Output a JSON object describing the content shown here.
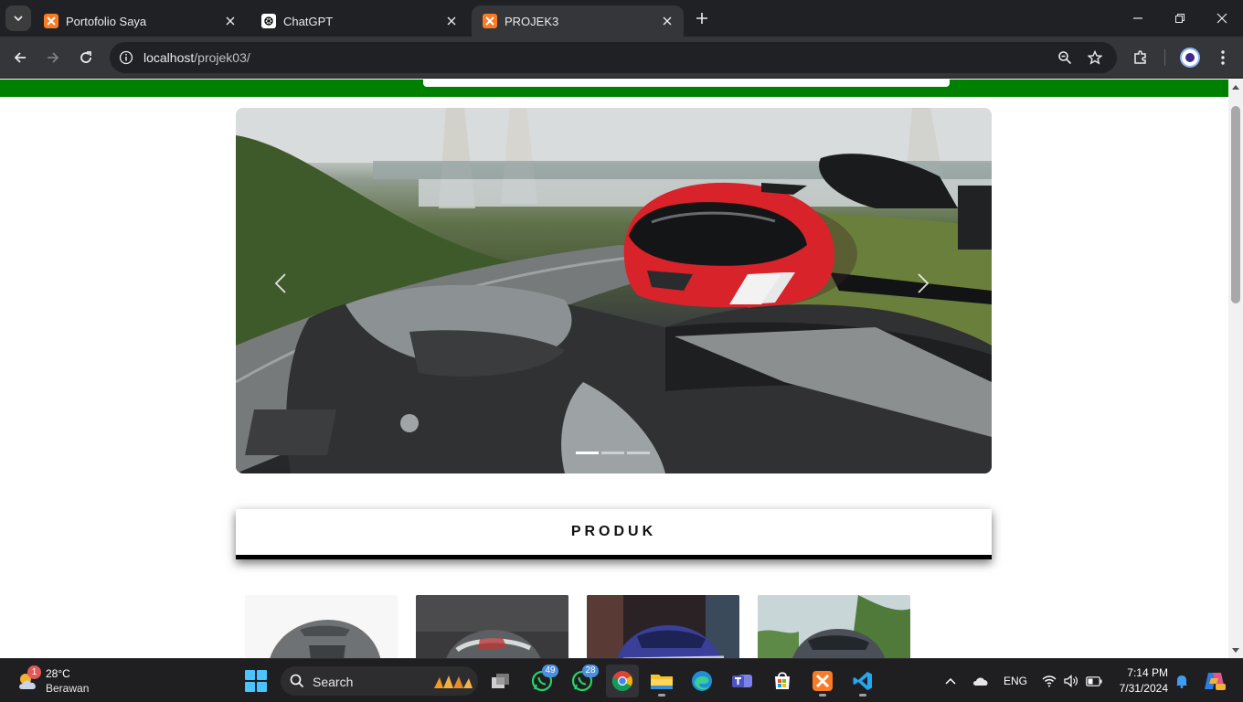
{
  "browser": {
    "tabs": [
      {
        "title": "Portofolio Saya",
        "favicon": "xampp-icon",
        "active": false
      },
      {
        "title": "ChatGPT",
        "favicon": "chatgpt-icon",
        "active": false
      },
      {
        "title": "PROJEK3",
        "favicon": "xampp-icon",
        "active": true
      }
    ],
    "url_host": "localhost",
    "url_path": "/projek03/"
  },
  "page": {
    "nav_color": "#008000",
    "carousel": {
      "slide_count": 3,
      "active_slide": 1,
      "prev_label": "Previous",
      "next_label": "Next"
    },
    "section_title": "PRODUK",
    "product_cards": [
      {
        "name": "helmet-gray"
      },
      {
        "name": "helmet-chrome"
      },
      {
        "name": "helmet-blue"
      },
      {
        "name": "helmet-dark"
      }
    ]
  },
  "taskbar": {
    "weather": {
      "temp": "28°C",
      "condition": "Berawan",
      "badge": "1"
    },
    "search_placeholder": "Search",
    "whatsapp_badge_1": "49",
    "whatsapp_badge_2": "28",
    "language": "ENG",
    "time": "7:14 PM",
    "date": "7/31/2024"
  },
  "colors": {
    "chrome_dark": "#202124",
    "chrome_tab": "#35363a",
    "accent_green": "#008000",
    "windows_blue": "#4cc2ff"
  }
}
